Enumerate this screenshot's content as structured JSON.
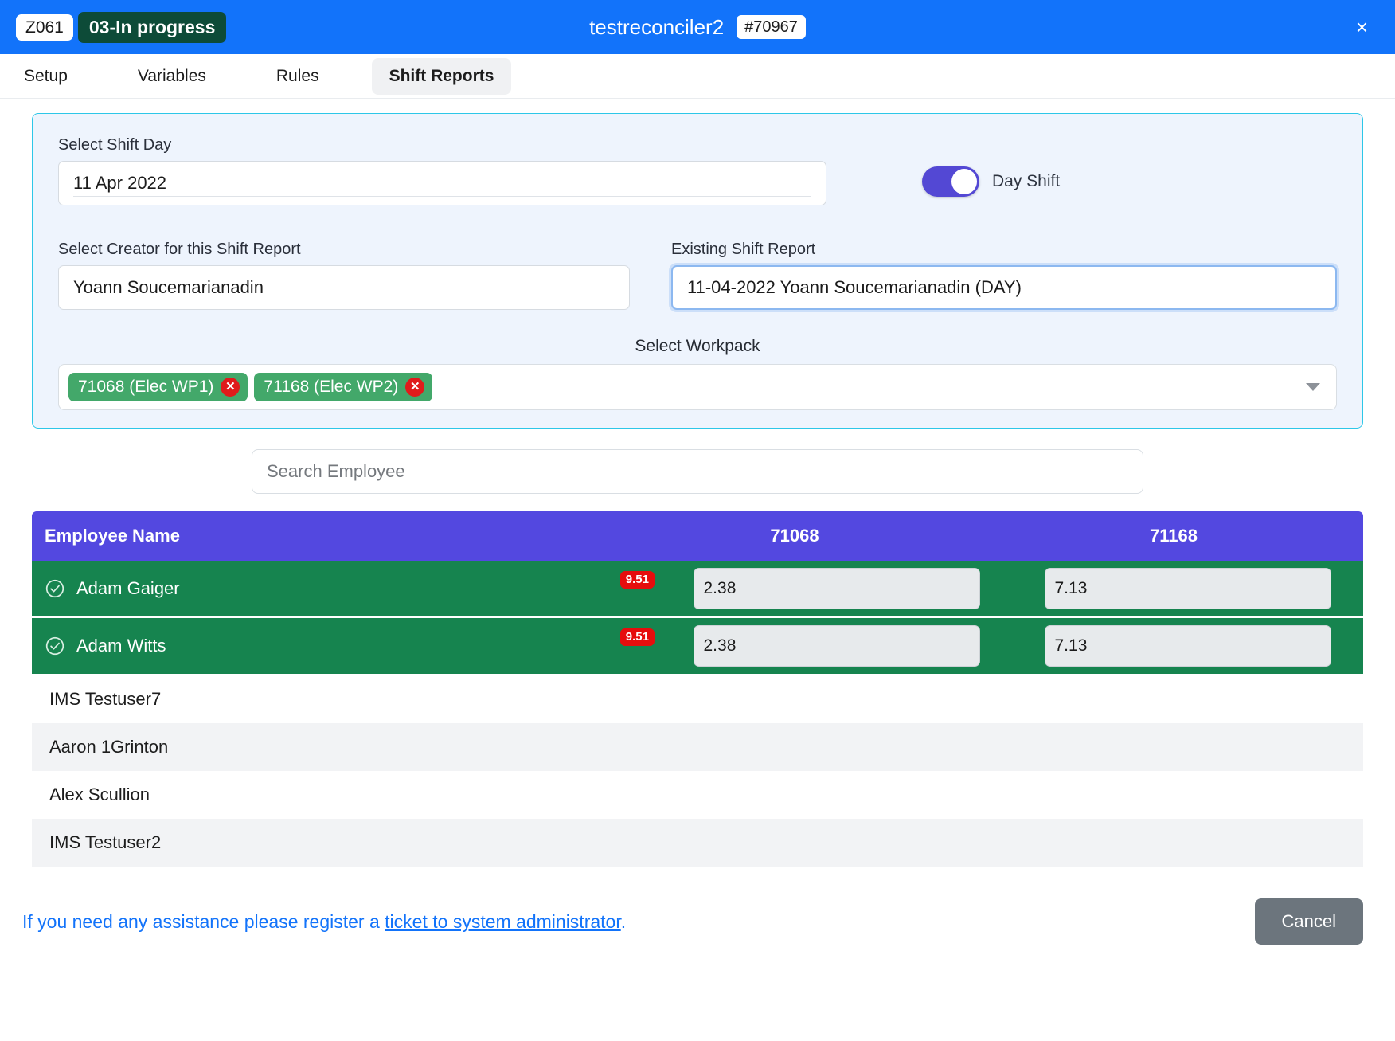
{
  "titlebar": {
    "code_chip": "Z061",
    "status_chip": "03-In progress",
    "title": "testreconciler2",
    "id_chip": "#70967",
    "close_icon": "close-icon",
    "close_glyph": "×",
    "bg_color": "#1273fa",
    "status_color": "#0d4b38"
  },
  "tabs": [
    {
      "label": "Setup",
      "active": false
    },
    {
      "label": "Variables",
      "active": false
    },
    {
      "label": "Rules",
      "active": false
    },
    {
      "label": "Shift Reports",
      "active": true
    }
  ],
  "form": {
    "shift_day_label": "Select Shift Day",
    "shift_day_value": "11 Apr 2022",
    "shift_toggle_label": "Day Shift",
    "shift_toggle_on": true,
    "toggle_color": "#5348d4",
    "creator_label": "Select Creator for this Shift Report",
    "creator_value": "Yoann Soucemarianadin",
    "existing_label": "Existing Shift Report",
    "existing_value": "11-04-2022 Yoann Soucemarianadin (DAY)",
    "workpack_label": "Select Workpack",
    "workpack_chips": [
      {
        "label": "71068 (Elec WP1)",
        "remove_glyph": "✕"
      },
      {
        "label": "71168 (Elec WP2)",
        "remove_glyph": "✕"
      }
    ],
    "chip_color": "#43a86a",
    "chip_remove_color": "#e01b1b",
    "panel_border_color": "#2dc7e8"
  },
  "search": {
    "placeholder": "Search Employee",
    "value": ""
  },
  "table": {
    "header_color": "#5348e0",
    "selected_row_color": "#16844f",
    "badge_color": "#e60d0d",
    "columns": [
      "Employee Name",
      "71068",
      "71168"
    ],
    "selected_rows": [
      {
        "name": "Adam Gaiger",
        "check_icon": "check-circle-icon",
        "badge": "9.51",
        "values": [
          "2.38",
          "7.13"
        ]
      },
      {
        "name": "Adam Witts",
        "check_icon": "check-circle-icon",
        "badge": "9.51",
        "values": [
          "2.38",
          "7.13"
        ]
      }
    ],
    "other_rows": [
      "IMS Testuser7",
      "Aaron 1Grinton",
      "Alex Scullion",
      "IMS Testuser2"
    ]
  },
  "footer": {
    "assist_prefix": "If you need any assistance please register a ",
    "assist_link": "ticket to system administrator",
    "assist_suffix": ".",
    "cancel_label": "Cancel",
    "cancel_color": "#6c757d",
    "link_color": "#1273fa"
  }
}
